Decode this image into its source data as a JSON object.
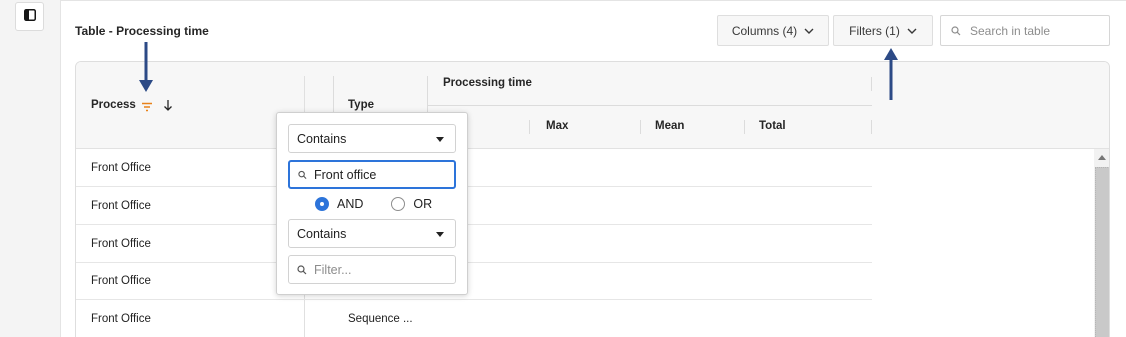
{
  "sidebar": {
    "toggle_icon": "panel-toggle-icon"
  },
  "table": {
    "title": "Table - Processing time",
    "columns_button": "Columns (4)",
    "filters_button": "Filters (1)",
    "search_placeholder": "Search in table",
    "headers": {
      "process": "Process",
      "type": "Type",
      "group": "Processing time",
      "max": "Max",
      "mean": "Mean",
      "total": "Total"
    },
    "rows": [
      {
        "process": "Front Office",
        "type": ""
      },
      {
        "process": "Front Office",
        "type": ""
      },
      {
        "process": "Front Office",
        "type": ""
      },
      {
        "process": "Front Office",
        "type": ""
      },
      {
        "process": "Front Office",
        "type": "Sequence ..."
      }
    ]
  },
  "filter_popup": {
    "condition1": "Contains",
    "value1": "Front office",
    "and_label": "AND",
    "or_label": "OR",
    "operator_selected": "AND",
    "condition2": "Contains",
    "value2_placeholder": "Filter..."
  },
  "colors": {
    "accent": "#2d74da",
    "filter_icon": "#e8821a",
    "annotation_arrow": "#2c4a86"
  }
}
